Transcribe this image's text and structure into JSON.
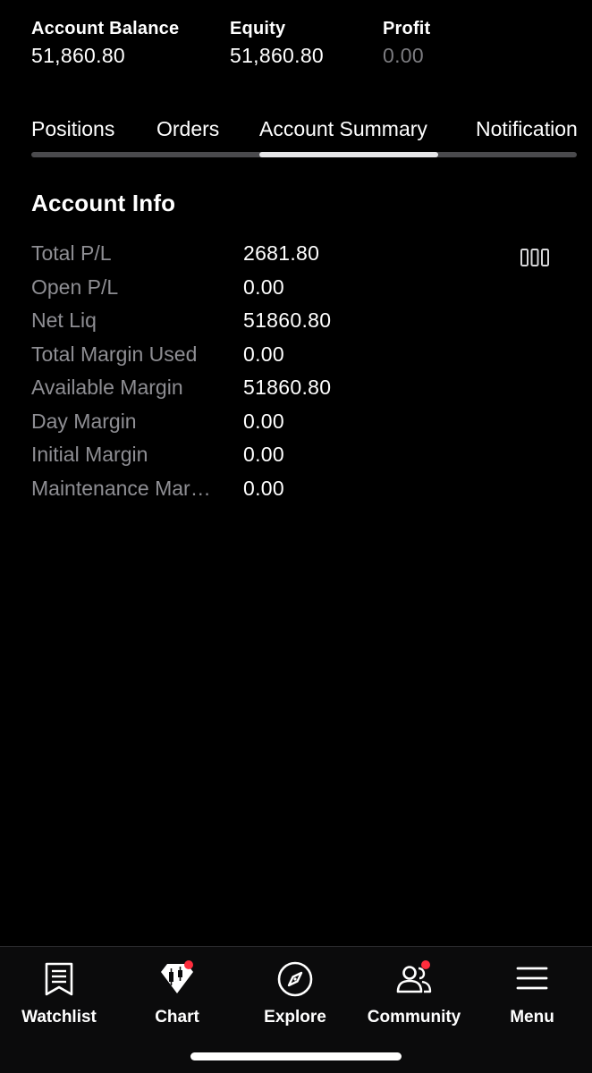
{
  "summary": {
    "account_balance": {
      "label": "Account Balance",
      "value": "51,860.80"
    },
    "equity": {
      "label": "Equity",
      "value": "51,860.80"
    },
    "profit": {
      "label": "Profit",
      "value": "0.00"
    }
  },
  "tabs": [
    {
      "label": "Positions",
      "active": false
    },
    {
      "label": "Orders",
      "active": false
    },
    {
      "label": "Account Summary",
      "active": true
    },
    {
      "label": "Notifications",
      "active": false
    }
  ],
  "account_info": {
    "title": "Account Info",
    "rows": [
      {
        "label": "Total P/L",
        "value": "2681.80"
      },
      {
        "label": "Open P/L",
        "value": "0.00"
      },
      {
        "label": "Net Liq",
        "value": "51860.80"
      },
      {
        "label": "Total Margin Used",
        "value": "0.00"
      },
      {
        "label": "Available Margin",
        "value": "51860.80"
      },
      {
        "label": "Day Margin",
        "value": "0.00"
      },
      {
        "label": "Initial Margin",
        "value": "0.00"
      },
      {
        "label": "Maintenance Margin",
        "value": "0.00"
      }
    ],
    "columns_icon": "columns-icon"
  },
  "bottom_nav": [
    {
      "label": "Watchlist",
      "icon": "watchlist-icon",
      "badge": false
    },
    {
      "label": "Chart",
      "icon": "chart-icon",
      "badge": true
    },
    {
      "label": "Explore",
      "icon": "compass-icon",
      "badge": false
    },
    {
      "label": "Community",
      "icon": "community-icon",
      "badge": true
    },
    {
      "label": "Menu",
      "icon": "menu-icon",
      "badge": false
    }
  ],
  "colors": {
    "background": "#000000",
    "text_primary": "#ffffff",
    "text_secondary": "#8e8e93",
    "tab_indicator": "#e6e6e8",
    "badge": "#ff2d3d"
  }
}
